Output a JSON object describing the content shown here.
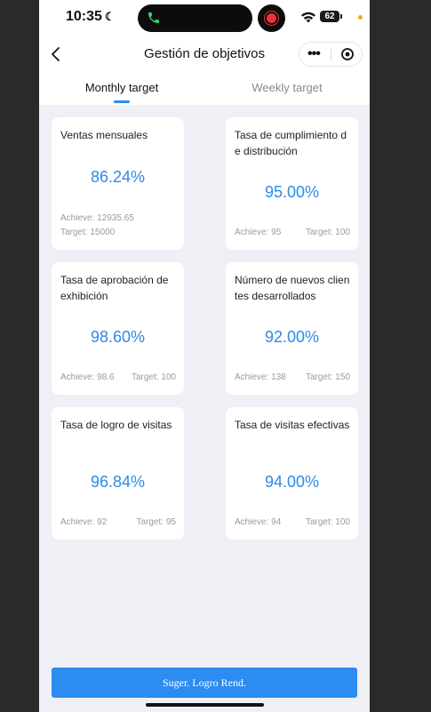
{
  "status": {
    "time": "10:35",
    "battery": "62"
  },
  "navbar": {
    "title": "Gestión de objetivos"
  },
  "tabs": [
    {
      "label": "Monthly target",
      "active": true
    },
    {
      "label": "Weekly target",
      "active": false
    }
  ],
  "colors": {
    "accent": "#2d8cf0",
    "percent_text": "#2d8ae8",
    "background": "#efeff6"
  },
  "cards": [
    {
      "title": "Ventas mensuales",
      "percent": "86.24%",
      "achieve": "Achieve: 12935.65",
      "target": "Target: 15000"
    },
    {
      "title": "Tasa de cumplimiento de distribución",
      "percent": "95.00%",
      "achieve": "Achieve: 95",
      "target": "Target: 100"
    },
    {
      "title": "Tasa de aprobación de exhibición",
      "percent": "98.60%",
      "achieve": "Achieve: 98.6",
      "target": "Target: 100"
    },
    {
      "title": "Número de nuevos clientes desarrollados",
      "percent": "92.00%",
      "achieve": "Achieve: 138",
      "target": "Target: 150"
    },
    {
      "title": "Tasa de logro de visitas",
      "percent": "96.84%",
      "achieve": "Achieve: 92",
      "target": "Target: 95"
    },
    {
      "title": "Tasa de visitas efectivas",
      "percent": "94.00%",
      "achieve": "Achieve: 94",
      "target": "Target: 100"
    }
  ],
  "footer": {
    "button_label": "Suger. Logro Rend."
  },
  "icons": [
    "moon-icon",
    "phone-call-icon",
    "screen-record-icon",
    "wifi-icon",
    "battery-icon",
    "back-arrow-icon",
    "more-dots-icon",
    "target-circle-icon"
  ]
}
